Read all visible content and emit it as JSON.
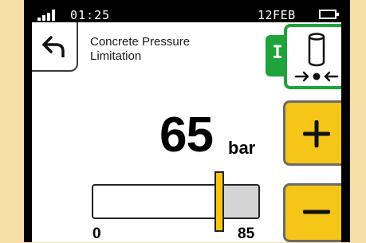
{
  "status_bar": {
    "time": "01:25",
    "date": "12FEB"
  },
  "header": {
    "title": "Concrete Pressure\nLimitation"
  },
  "mode": {
    "indicator_label": "I"
  },
  "pressure": {
    "value": "65",
    "unit": "bar",
    "level": 65,
    "min": 0,
    "max": 85,
    "min_label": "0",
    "max_label": "85"
  },
  "colors": {
    "accent_yellow": "#f5c518",
    "mode_green": "#1fa33a",
    "background": "#f7dfa8"
  },
  "icons": {
    "back": "back-arrow-icon",
    "mode": "cylinder-pressure-icon",
    "increase": "plus-icon",
    "decrease": "minus-icon"
  }
}
